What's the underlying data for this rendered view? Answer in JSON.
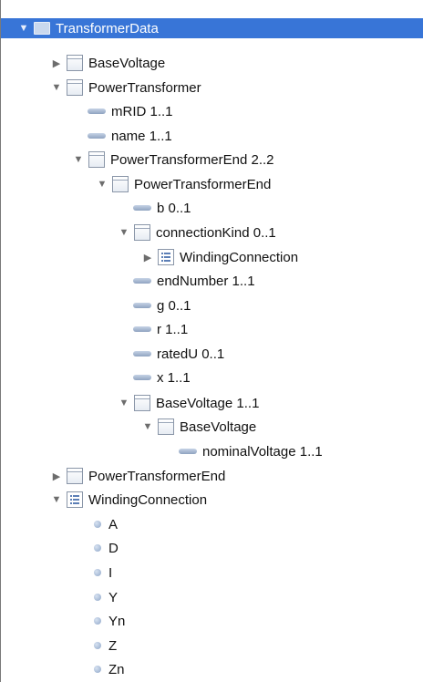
{
  "tree": [
    {
      "label": "TransformerData",
      "icon": "folder-icon",
      "state": "expanded",
      "selected": true
    },
    {
      "label": "BaseVoltage",
      "icon": "class-icon",
      "state": "collapsed"
    },
    {
      "label": "PowerTransformer",
      "icon": "class-icon",
      "state": "expanded"
    },
    {
      "label": "mRID 1..1",
      "icon": "property-icon",
      "state": "leaf"
    },
    {
      "label": "name 1..1",
      "icon": "property-icon",
      "state": "leaf"
    },
    {
      "label": "PowerTransformerEnd 2..2",
      "icon": "class-icon",
      "state": "expanded"
    },
    {
      "label": "PowerTransformerEnd",
      "icon": "class-icon",
      "state": "expanded"
    },
    {
      "label": "b 0..1",
      "icon": "property-icon",
      "state": "leaf"
    },
    {
      "label": "connectionKind 0..1",
      "icon": "class-icon",
      "state": "expanded"
    },
    {
      "label": "WindingConnection",
      "icon": "enumeration-icon",
      "state": "collapsed"
    },
    {
      "label": "endNumber 1..1",
      "icon": "property-icon",
      "state": "leaf"
    },
    {
      "label": "g 0..1",
      "icon": "property-icon",
      "state": "leaf"
    },
    {
      "label": "r 1..1",
      "icon": "property-icon",
      "state": "leaf"
    },
    {
      "label": "ratedU 0..1",
      "icon": "property-icon",
      "state": "leaf"
    },
    {
      "label": "x 1..1",
      "icon": "property-icon",
      "state": "leaf"
    },
    {
      "label": "BaseVoltage 1..1",
      "icon": "class-icon",
      "state": "expanded"
    },
    {
      "label": "BaseVoltage",
      "icon": "class-icon",
      "state": "expanded"
    },
    {
      "label": "nominalVoltage 1..1",
      "icon": "property-icon",
      "state": "leaf"
    },
    {
      "label": "PowerTransformerEnd",
      "icon": "class-icon",
      "state": "collapsed"
    },
    {
      "label": "WindingConnection",
      "icon": "enumeration-icon",
      "state": "expanded"
    },
    {
      "label": "A",
      "icon": "literal-icon",
      "state": "leaf"
    },
    {
      "label": "D",
      "icon": "literal-icon",
      "state": "leaf"
    },
    {
      "label": "I",
      "icon": "literal-icon",
      "state": "leaf"
    },
    {
      "label": "Y",
      "icon": "literal-icon",
      "state": "leaf"
    },
    {
      "label": "Yn",
      "icon": "literal-icon",
      "state": "leaf"
    },
    {
      "label": "Z",
      "icon": "literal-icon",
      "state": "leaf"
    },
    {
      "label": "Zn",
      "icon": "literal-icon",
      "state": "leaf"
    }
  ],
  "colors": {
    "selection": "#3875d7",
    "disclosure": "#6d6d6d",
    "border": "#7a7a7a"
  }
}
